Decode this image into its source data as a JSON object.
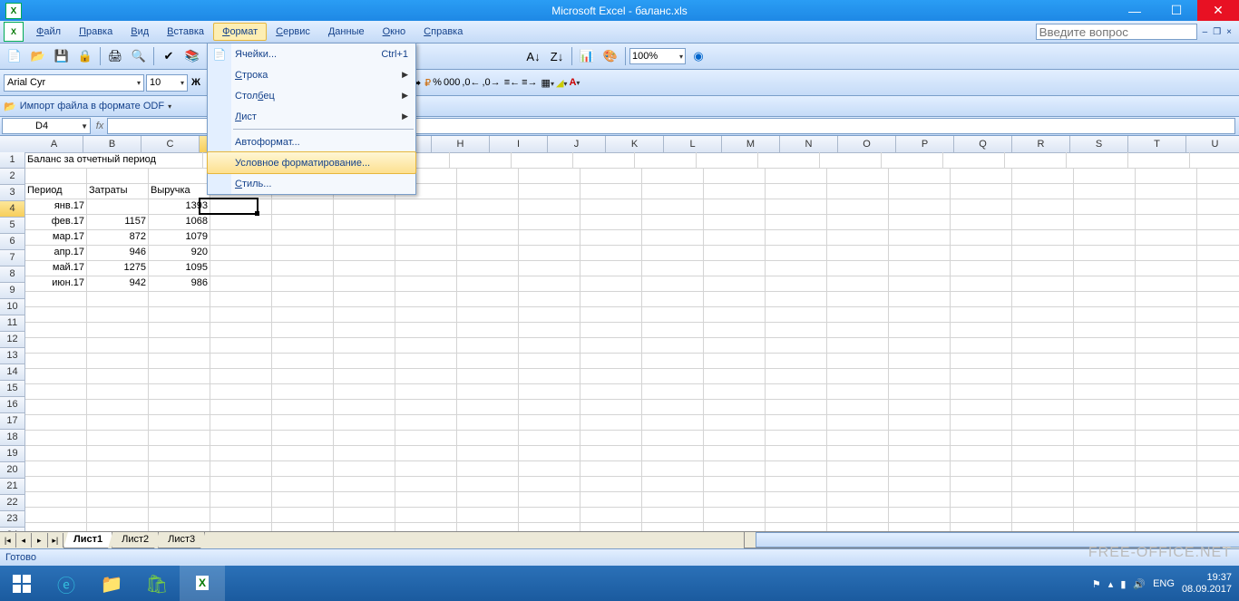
{
  "window": {
    "title": "Microsoft Excel - баланс.xls"
  },
  "menubar": {
    "items": [
      "Файл",
      "Правка",
      "Вид",
      "Вставка",
      "Формат",
      "Сервис",
      "Данные",
      "Окно",
      "Справка"
    ],
    "active_index": 4,
    "question_placeholder": "Введите вопрос"
  },
  "toolbar": {
    "zoom": "100%"
  },
  "formatbar": {
    "font": "Arial Cyr",
    "size": "10"
  },
  "odf": {
    "label": "Импорт файла в формате ODF"
  },
  "name_box": "D4",
  "dropdown": {
    "items": [
      {
        "label": "Ячейки...",
        "shortcut": "Ctrl+1",
        "icon": "📄"
      },
      {
        "label": "Строка",
        "submenu": true,
        "u": 0
      },
      {
        "label": "Столбец",
        "submenu": true,
        "u": 4
      },
      {
        "label": "Лист",
        "submenu": true,
        "u": 0
      },
      {
        "sep": true
      },
      {
        "label": "Автоформат..."
      },
      {
        "label": "Условное форматирование...",
        "highlight": true
      },
      {
        "label": "Стиль...",
        "u": 0
      }
    ]
  },
  "columns": [
    "A",
    "B",
    "C",
    "D",
    "E",
    "F",
    "G",
    "H",
    "I",
    "J",
    "K",
    "L",
    "M",
    "N",
    "O",
    "P",
    "Q",
    "R",
    "S",
    "T",
    "U"
  ],
  "rows_shown": 25,
  "active": {
    "row": 4,
    "col": "D"
  },
  "data": {
    "1": {
      "A": "Баланс за отчетный период",
      "span": 3
    },
    "3": {
      "A": "Период",
      "B": "Затраты",
      "C": "Выручка"
    },
    "4": {
      "A": "янв.17",
      "B": "",
      "C": "1393"
    },
    "5": {
      "A": "фев.17",
      "B": "1157",
      "C": "1068"
    },
    "6": {
      "A": "мар.17",
      "B": "872",
      "C": "1079"
    },
    "7": {
      "A": "апр.17",
      "B": "946",
      "C": "920"
    },
    "8": {
      "A": "май.17",
      "B": "1275",
      "C": "1095"
    },
    "9": {
      "A": "июн.17",
      "B": "942",
      "C": "986"
    }
  },
  "sheets": {
    "tabs": [
      "Лист1",
      "Лист2",
      "Лист3"
    ],
    "active": 0
  },
  "status": "Готово",
  "tray": {
    "lang": "ENG",
    "time": "19:37",
    "date": "08.09.2017"
  },
  "watermark": "FREE-OFFICE.NET"
}
